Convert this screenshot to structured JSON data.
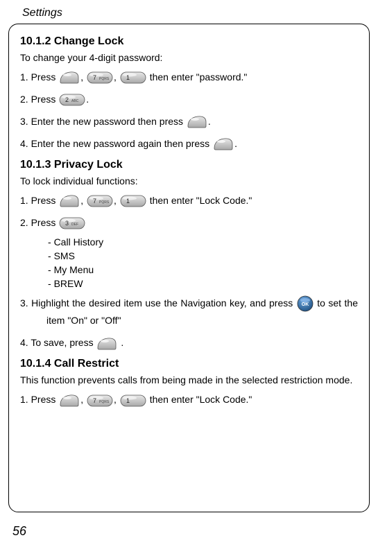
{
  "header": "Settings",
  "page_number": "56",
  "s1": {
    "title": "10.1.2 Change Lock",
    "intro": "To change your 4-digit password:",
    "step1_a": "1.  Press ",
    "step1_b": ", ",
    "step1_c": ", ",
    "step1_d": " then enter \"password.\"",
    "step2_a": "2.  Press ",
    "step2_b": ".",
    "step3_a": "3.  Enter the new password then press ",
    "step3_b": ".",
    "step4_a": "4.  Enter the new password again then press ",
    "step4_b": "."
  },
  "s2": {
    "title": "10.1.3 Privacy Lock",
    "intro": "To lock individual functions:",
    "step1_a": "1.  Press ",
    "step1_b": ", ",
    "step1_c": ", ",
    "step1_d": " then enter \"Lock Code.\"",
    "step2_a": "2.  Press ",
    "sub1": "Call History",
    "sub2": "SMS",
    "sub3": "My Menu",
    "sub4": "BREW",
    "step3_a": "3.  Highlight the desired item use the Navigation key, and press ",
    "step3_b": " to set the item \"On\" or \"Off\"",
    "step4_a": "4.  To save, press ",
    "step4_b": " ."
  },
  "s3": {
    "title": "10.1.4 Call Restrict",
    "intro": "This function prevents calls from being made in the selected restriction mode.",
    "step1_a": "1.  Press ",
    "step1_b": ", ",
    "step1_c": ", ",
    "step1_d": " then enter \"Lock Code.\""
  }
}
